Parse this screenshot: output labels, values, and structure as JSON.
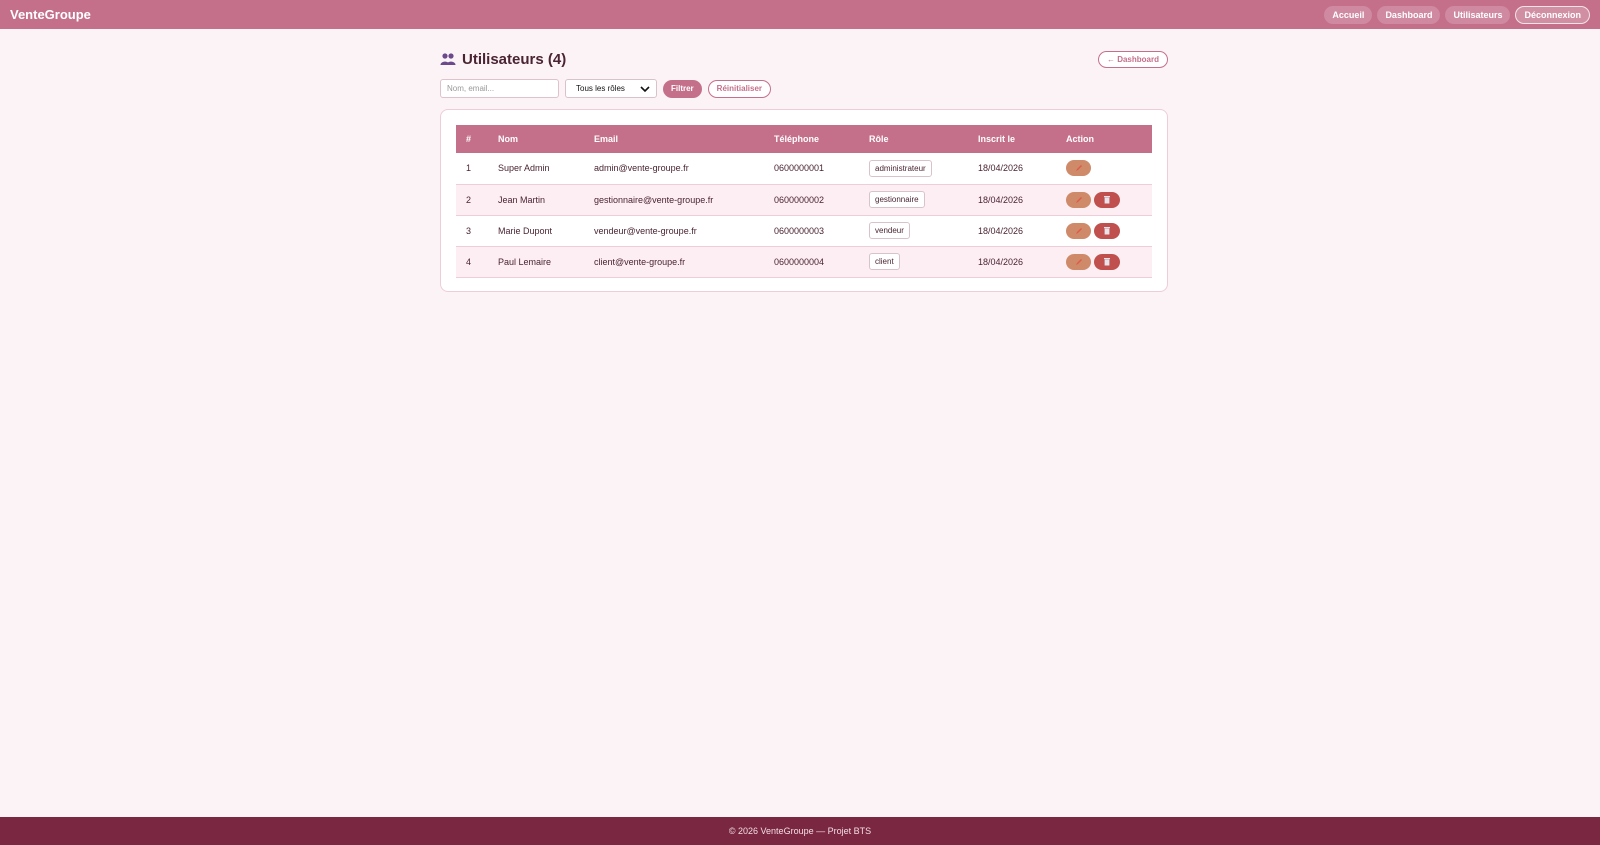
{
  "navbar": {
    "brand": "VenteGroupe",
    "links": [
      "Accueil",
      "Dashboard",
      "Utilisateurs"
    ],
    "logout": "Déconnexion"
  },
  "page": {
    "title": "Utilisateurs (4)",
    "back_button": "← Dashboard"
  },
  "filters": {
    "search_placeholder": "Nom, email...",
    "role_selected": "Tous les rôles",
    "filter_button": "Filtrer",
    "reset_button": "Réinitialiser"
  },
  "table": {
    "headers": [
      "#",
      "Nom",
      "Email",
      "Téléphone",
      "Rôle",
      "Inscrit le",
      "Action"
    ],
    "rows": [
      {
        "id": "1",
        "name": "Super Admin",
        "email": "admin@vente-groupe.fr",
        "phone": "0600000001",
        "role": "administrateur",
        "date": "18/04/2026",
        "can_delete": false
      },
      {
        "id": "2",
        "name": "Jean Martin",
        "email": "gestionnaire@vente-groupe.fr",
        "phone": "0600000002",
        "role": "gestionnaire",
        "date": "18/04/2026",
        "can_delete": true
      },
      {
        "id": "3",
        "name": "Marie Dupont",
        "email": "vendeur@vente-groupe.fr",
        "phone": "0600000003",
        "role": "vendeur",
        "date": "18/04/2026",
        "can_delete": true
      },
      {
        "id": "4",
        "name": "Paul Lemaire",
        "email": "client@vente-groupe.fr",
        "phone": "0600000004",
        "role": "client",
        "date": "18/04/2026",
        "can_delete": true
      }
    ]
  },
  "footer": {
    "text": "© 2026 VenteGroupe — Projet BTS"
  },
  "colors": {
    "primary": "#c5708b",
    "footer": "#7a2842",
    "edit": "#cf8a6a",
    "delete": "#c0504d"
  }
}
